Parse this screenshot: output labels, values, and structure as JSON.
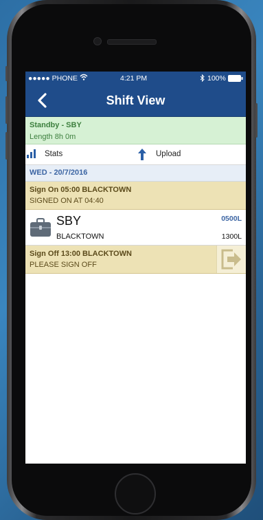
{
  "status_bar": {
    "carrier": "●●●●● PHONE",
    "time": "4:21 PM",
    "battery": "100%"
  },
  "nav": {
    "title": "Shift View",
    "back_icon": "chevron-left-icon"
  },
  "standby": {
    "title": "Standby - SBY",
    "length": "Length 8h 0m"
  },
  "actions": {
    "stats_label": "Stats",
    "upload_label": "Upload"
  },
  "day": {
    "date": "WED - 20/7/2016"
  },
  "sign_on": {
    "title": "Sign On 05:00 BLACKTOWN",
    "status": "SIGNED ON AT 04:40"
  },
  "duty": {
    "code": "SBY",
    "location": "BLACKTOWN",
    "start": "0500L",
    "end": "1300L",
    "icon": "briefcase-icon"
  },
  "sign_off": {
    "title": "Sign Off 13:00 BLACKTOWN",
    "status": "PLEASE SIGN OFF",
    "icon": "sign-out-icon"
  },
  "colors": {
    "nav_blue": "#1f4c8a",
    "standby_green": "#d6f1d4",
    "sign_tan": "#ede2b5",
    "date_blue": "#3c65a3"
  }
}
